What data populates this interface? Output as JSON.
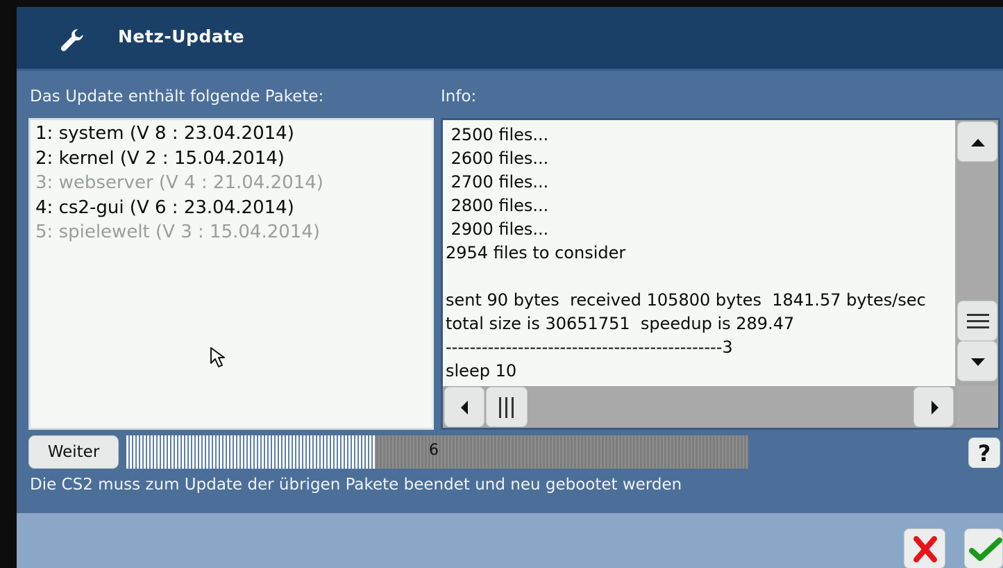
{
  "window": {
    "title": "Netz-Update",
    "icon": "wrench-icon"
  },
  "packages": {
    "label": "Das Update enthält folgende Pakete:",
    "items": [
      {
        "text": "1: system (V 8 : 23.04.2014)",
        "state": "active"
      },
      {
        "text": "2: kernel (V 2 : 15.04.2014)",
        "state": "active"
      },
      {
        "text": "3: webserver (V 4 : 21.04.2014)",
        "state": "inactive"
      },
      {
        "text": "4: cs2-gui (V 6 : 23.04.2014)",
        "state": "active"
      },
      {
        "text": "5: spielewelt (V 3 : 15.04.2014)",
        "state": "inactive"
      }
    ]
  },
  "info": {
    "label": "Info:",
    "lines": [
      " 2500 files...",
      " 2600 files...",
      " 2700 files...",
      " 2800 files...",
      " 2900 files...",
      "2954 files to consider",
      "",
      "sent 90 bytes  received 105800 bytes  1841.57 bytes/sec",
      "total size is 30651751  speedup is 289.47",
      "----------------------------------------------3",
      "sleep 10"
    ]
  },
  "controls": {
    "weiter_label": "Weiter",
    "progress_value": 0.4,
    "progress_text": "6",
    "help_label": "?"
  },
  "status": {
    "message": "Die CS2 muss zum Update der übrigen Pakete beendet und neu gebootet werden"
  },
  "colors": {
    "titlebar": "#1b4068",
    "dialog": "#4b6f98",
    "footer": "#8aa7c8",
    "cancel": "#e8141c",
    "ok": "#1a9a1a"
  }
}
